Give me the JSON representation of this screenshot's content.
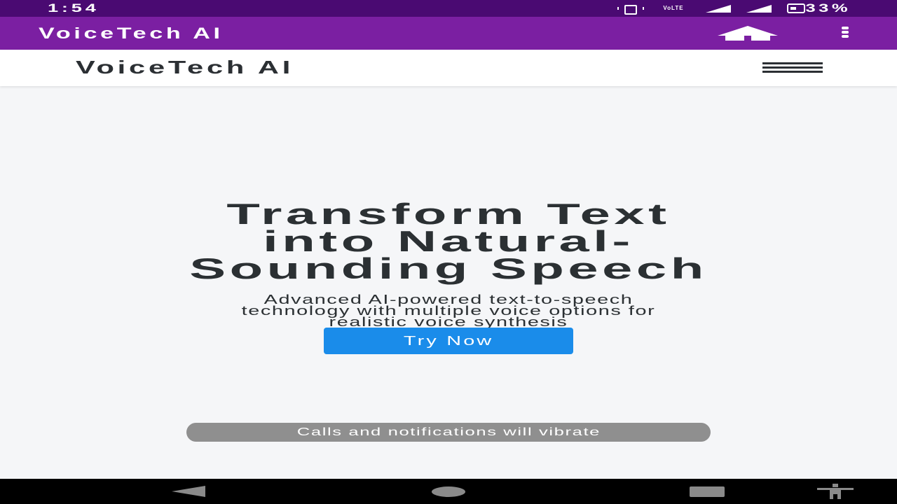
{
  "status_bar": {
    "time": "1:54",
    "network": "VoLTE",
    "battery": "33%"
  },
  "app_bar": {
    "title": "VoiceTech AI",
    "home_icon": "home-icon",
    "menu_icon": "more-vert-icon"
  },
  "site_header": {
    "logo": "VoiceTech AI",
    "menu_icon": "hamburger-icon"
  },
  "hero": {
    "title_lines": [
      "Transform Text",
      "into Natural-",
      "Sounding Speech"
    ],
    "subtitle_lines": [
      "Advanced AI-powered text-to-speech",
      "technology with multiple voice options for",
      "realistic voice synthesis"
    ],
    "cta_label": "Try Now"
  },
  "toast": {
    "message": "Calls and notifications will vibrate"
  },
  "nav_bar": {
    "icons": [
      "back-icon",
      "home-circle-icon",
      "recents-icon",
      "accessibility-icon"
    ]
  },
  "colors": {
    "status_bar": "#4a0a72",
    "app_bar": "#7b1fa2",
    "cta": "#1a8cea",
    "toast": "#8f8f8f",
    "text": "#2b3033"
  }
}
